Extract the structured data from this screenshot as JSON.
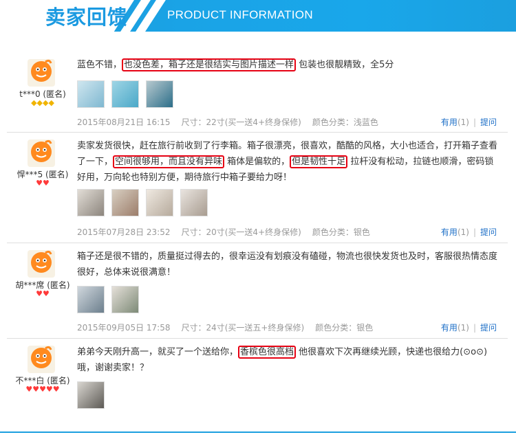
{
  "header": {
    "title_cn": "卖家回馈",
    "title_en": "PRODUCT INFORMATION",
    "accent": "#1b9fdf"
  },
  "reviews": [
    {
      "user": "t***0 (匿名)",
      "rank": "gold-diamonds-4",
      "text_before": "蓝色不错，",
      "highlight": "也没色差，箱子还是很结实与图片描述一样",
      "text_after": " 包装也很靓精致，全5分",
      "date": "2015年08月21日 16:15",
      "size": "尺寸：22寸(买一送4+终身保修)",
      "color": "颜色分类：浅蓝色",
      "useful": "有用",
      "useful_count": "(1)",
      "ask": "提问"
    },
    {
      "user": "悍***5 (匿名)",
      "rank": "red-hearts-2",
      "text_a": "卖家发货很快，赶在旅行前收到了行李箱。箱子很漂亮，很喜欢，酷酷的风格，大小也适合，打开箱子查看了一下，",
      "highlight_a": "空间很够用，而且没有异味",
      "text_b": " 箱体是偏软的，",
      "highlight_b": "但是韧性十足",
      "text_c": " 拉杆没有松动，拉链也顺滑，密码锁好用，万向轮也特别方便，期待旅行中箱子要给力呀！",
      "date": "2015年07月28日 23:52",
      "size": "尺寸：20寸(买一送4+终身保修)",
      "color": "颜色分类：银色",
      "useful": "有用",
      "useful_count": "(1)",
      "ask": "提问"
    },
    {
      "user": "胡***席 (匿名)",
      "rank": "red-hearts-2",
      "text": "箱子还是很不错的，质量挺过得去的，很幸运没有划痕没有磕碰，物流也很快发货也及时，客服很热情态度很好，总体来说很满意！",
      "date": "2015年09月05日 17:58",
      "size": "尺寸：24寸(买一送五+终身保修)",
      "color": "颜色分类：银色",
      "useful": "有用",
      "useful_count": "(1)",
      "ask": "提问"
    },
    {
      "user": "不***白 (匿名)",
      "rank": "red-hearts-5",
      "text_before": "弟弟今天刚升高一，就买了一个送给你，",
      "highlight": "香槟色很高档",
      "text_after": " 他很喜欢下次再继续光顾，快递也很给力(⊙o⊙)哦，谢谢卖家！？"
    }
  ]
}
